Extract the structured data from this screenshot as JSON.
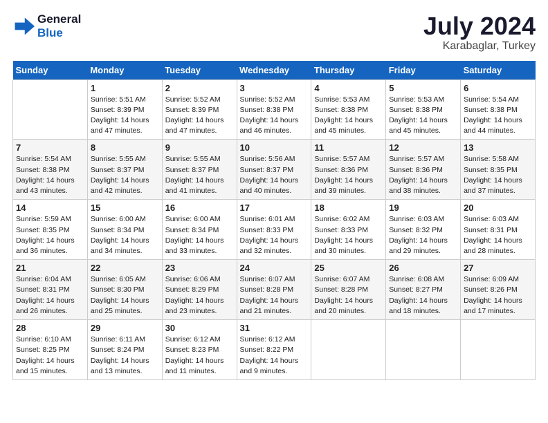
{
  "logo": {
    "line1": "General",
    "line2": "Blue"
  },
  "title": "July 2024",
  "subtitle": "Karabaglar, Turkey",
  "header_days": [
    "Sunday",
    "Monday",
    "Tuesday",
    "Wednesday",
    "Thursday",
    "Friday",
    "Saturday"
  ],
  "weeks": [
    [
      {
        "day": "",
        "info": ""
      },
      {
        "day": "1",
        "info": "Sunrise: 5:51 AM\nSunset: 8:39 PM\nDaylight: 14 hours\nand 47 minutes."
      },
      {
        "day": "2",
        "info": "Sunrise: 5:52 AM\nSunset: 8:39 PM\nDaylight: 14 hours\nand 47 minutes."
      },
      {
        "day": "3",
        "info": "Sunrise: 5:52 AM\nSunset: 8:38 PM\nDaylight: 14 hours\nand 46 minutes."
      },
      {
        "day": "4",
        "info": "Sunrise: 5:53 AM\nSunset: 8:38 PM\nDaylight: 14 hours\nand 45 minutes."
      },
      {
        "day": "5",
        "info": "Sunrise: 5:53 AM\nSunset: 8:38 PM\nDaylight: 14 hours\nand 45 minutes."
      },
      {
        "day": "6",
        "info": "Sunrise: 5:54 AM\nSunset: 8:38 PM\nDaylight: 14 hours\nand 44 minutes."
      }
    ],
    [
      {
        "day": "7",
        "info": "Sunrise: 5:54 AM\nSunset: 8:38 PM\nDaylight: 14 hours\nand 43 minutes."
      },
      {
        "day": "8",
        "info": "Sunrise: 5:55 AM\nSunset: 8:37 PM\nDaylight: 14 hours\nand 42 minutes."
      },
      {
        "day": "9",
        "info": "Sunrise: 5:55 AM\nSunset: 8:37 PM\nDaylight: 14 hours\nand 41 minutes."
      },
      {
        "day": "10",
        "info": "Sunrise: 5:56 AM\nSunset: 8:37 PM\nDaylight: 14 hours\nand 40 minutes."
      },
      {
        "day": "11",
        "info": "Sunrise: 5:57 AM\nSunset: 8:36 PM\nDaylight: 14 hours\nand 39 minutes."
      },
      {
        "day": "12",
        "info": "Sunrise: 5:57 AM\nSunset: 8:36 PM\nDaylight: 14 hours\nand 38 minutes."
      },
      {
        "day": "13",
        "info": "Sunrise: 5:58 AM\nSunset: 8:35 PM\nDaylight: 14 hours\nand 37 minutes."
      }
    ],
    [
      {
        "day": "14",
        "info": "Sunrise: 5:59 AM\nSunset: 8:35 PM\nDaylight: 14 hours\nand 36 minutes."
      },
      {
        "day": "15",
        "info": "Sunrise: 6:00 AM\nSunset: 8:34 PM\nDaylight: 14 hours\nand 34 minutes."
      },
      {
        "day": "16",
        "info": "Sunrise: 6:00 AM\nSunset: 8:34 PM\nDaylight: 14 hours\nand 33 minutes."
      },
      {
        "day": "17",
        "info": "Sunrise: 6:01 AM\nSunset: 8:33 PM\nDaylight: 14 hours\nand 32 minutes."
      },
      {
        "day": "18",
        "info": "Sunrise: 6:02 AM\nSunset: 8:33 PM\nDaylight: 14 hours\nand 30 minutes."
      },
      {
        "day": "19",
        "info": "Sunrise: 6:03 AM\nSunset: 8:32 PM\nDaylight: 14 hours\nand 29 minutes."
      },
      {
        "day": "20",
        "info": "Sunrise: 6:03 AM\nSunset: 8:31 PM\nDaylight: 14 hours\nand 28 minutes."
      }
    ],
    [
      {
        "day": "21",
        "info": "Sunrise: 6:04 AM\nSunset: 8:31 PM\nDaylight: 14 hours\nand 26 minutes."
      },
      {
        "day": "22",
        "info": "Sunrise: 6:05 AM\nSunset: 8:30 PM\nDaylight: 14 hours\nand 25 minutes."
      },
      {
        "day": "23",
        "info": "Sunrise: 6:06 AM\nSunset: 8:29 PM\nDaylight: 14 hours\nand 23 minutes."
      },
      {
        "day": "24",
        "info": "Sunrise: 6:07 AM\nSunset: 8:28 PM\nDaylight: 14 hours\nand 21 minutes."
      },
      {
        "day": "25",
        "info": "Sunrise: 6:07 AM\nSunset: 8:28 PM\nDaylight: 14 hours\nand 20 minutes."
      },
      {
        "day": "26",
        "info": "Sunrise: 6:08 AM\nSunset: 8:27 PM\nDaylight: 14 hours\nand 18 minutes."
      },
      {
        "day": "27",
        "info": "Sunrise: 6:09 AM\nSunset: 8:26 PM\nDaylight: 14 hours\nand 17 minutes."
      }
    ],
    [
      {
        "day": "28",
        "info": "Sunrise: 6:10 AM\nSunset: 8:25 PM\nDaylight: 14 hours\nand 15 minutes."
      },
      {
        "day": "29",
        "info": "Sunrise: 6:11 AM\nSunset: 8:24 PM\nDaylight: 14 hours\nand 13 minutes."
      },
      {
        "day": "30",
        "info": "Sunrise: 6:12 AM\nSunset: 8:23 PM\nDaylight: 14 hours\nand 11 minutes."
      },
      {
        "day": "31",
        "info": "Sunrise: 6:12 AM\nSunset: 8:22 PM\nDaylight: 14 hours\nand 9 minutes."
      },
      {
        "day": "",
        "info": ""
      },
      {
        "day": "",
        "info": ""
      },
      {
        "day": "",
        "info": ""
      }
    ]
  ]
}
